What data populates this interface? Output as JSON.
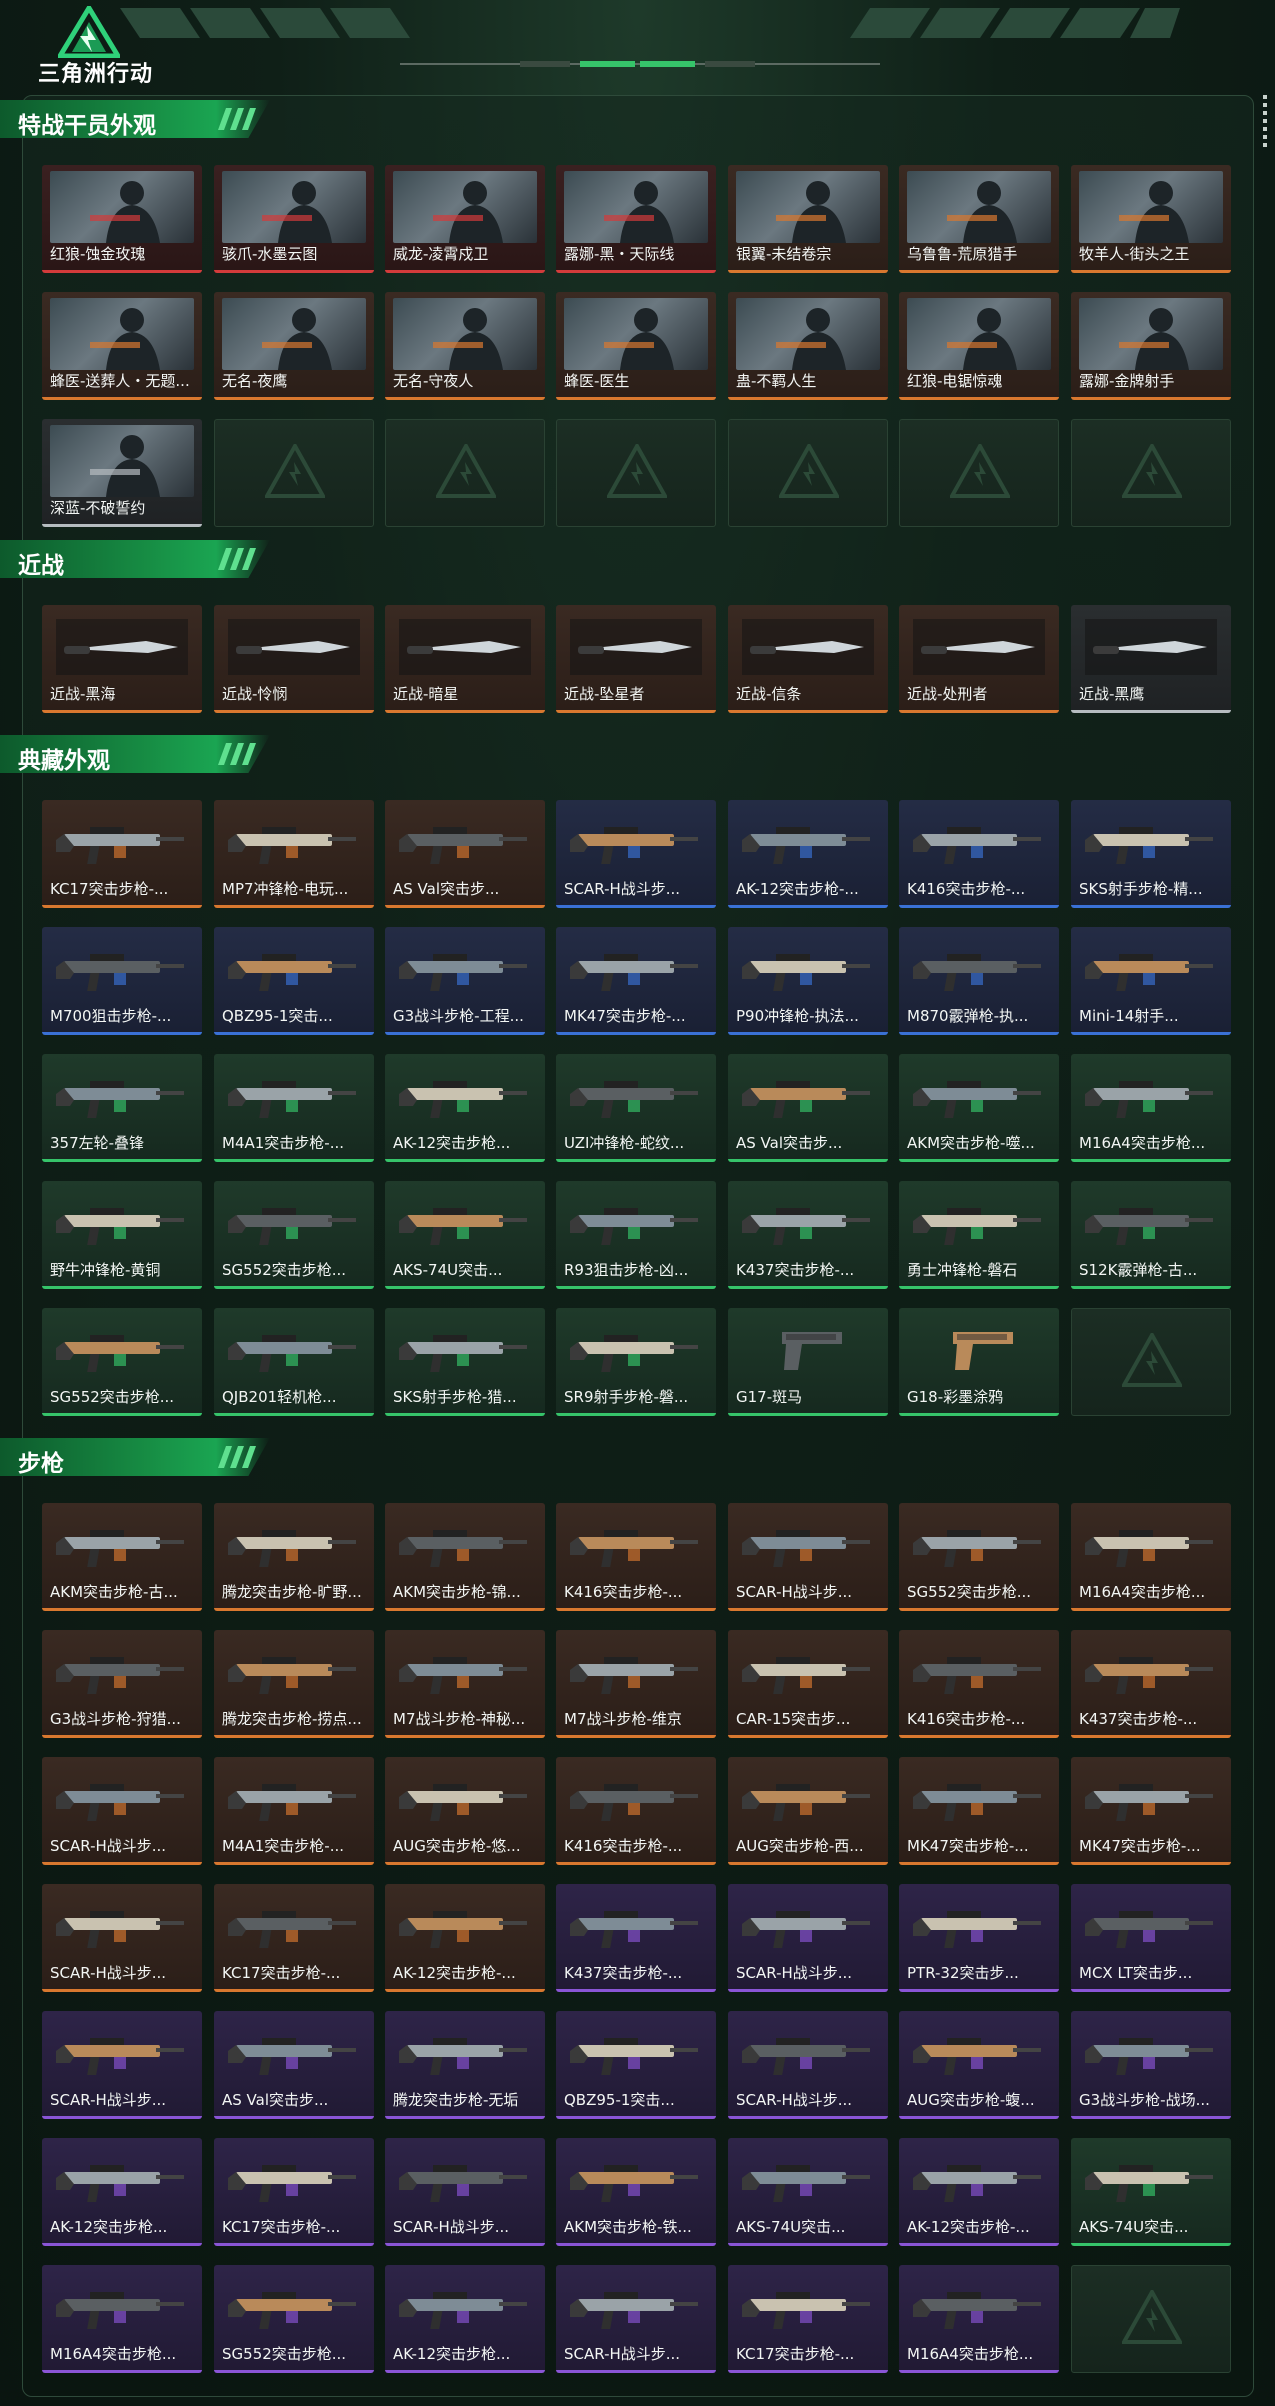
{
  "header": {
    "logo_text": "三角洲行动",
    "logo": "delta-triangle-logo"
  },
  "colors": {
    "orange": "#d9782f",
    "red": "#d33b3b",
    "blue": "#3a71d6",
    "green": "#36c46a",
    "purple": "#8a55d6",
    "grey": "#b6bcc0",
    "section_green": "#1aa552"
  },
  "sections": [
    {
      "title": "特战干员外观",
      "items": [
        {
          "label": "红狼-蚀金玫瑰",
          "rarity": "red",
          "kind": "operator"
        },
        {
          "label": "骇爪-水墨云图",
          "rarity": "red",
          "kind": "operator"
        },
        {
          "label": "威龙-凌霄戍卫",
          "rarity": "red",
          "kind": "operator"
        },
        {
          "label": "露娜-黑・天际线",
          "rarity": "red",
          "kind": "operator"
        },
        {
          "label": "银翼-未结卷宗",
          "rarity": "orange",
          "kind": "operator"
        },
        {
          "label": "乌鲁鲁-荒原猎手",
          "rarity": "orange",
          "kind": "operator"
        },
        {
          "label": "牧羊人-街头之王",
          "rarity": "orange",
          "kind": "operator"
        },
        {
          "label": "蜂医-送葬人・无题...",
          "rarity": "orange",
          "kind": "operator"
        },
        {
          "label": "无名-夜鹰",
          "rarity": "orange",
          "kind": "operator"
        },
        {
          "label": "无名-守夜人",
          "rarity": "orange",
          "kind": "operator"
        },
        {
          "label": "蜂医-医生",
          "rarity": "orange",
          "kind": "operator"
        },
        {
          "label": "蛊-不羁人生",
          "rarity": "orange",
          "kind": "operator"
        },
        {
          "label": "红狼-电锯惊魂",
          "rarity": "orange",
          "kind": "operator"
        },
        {
          "label": "露娜-金牌射手",
          "rarity": "orange",
          "kind": "operator"
        },
        {
          "label": "深蓝-不破誓约",
          "rarity": "grey",
          "kind": "operator"
        },
        {
          "empty": true
        },
        {
          "empty": true
        },
        {
          "empty": true
        },
        {
          "empty": true
        },
        {
          "empty": true
        },
        {
          "empty": true
        }
      ]
    },
    {
      "title": "近战",
      "items": [
        {
          "label": "近战-黑海",
          "rarity": "orange",
          "kind": "melee"
        },
        {
          "label": "近战-怜悯",
          "rarity": "orange",
          "kind": "melee"
        },
        {
          "label": "近战-暗星",
          "rarity": "orange",
          "kind": "melee"
        },
        {
          "label": "近战-坠星者",
          "rarity": "orange",
          "kind": "melee"
        },
        {
          "label": "近战-信条",
          "rarity": "orange",
          "kind": "melee"
        },
        {
          "label": "近战-处刑者",
          "rarity": "orange",
          "kind": "melee"
        },
        {
          "label": "近战-黑鹰",
          "rarity": "grey",
          "kind": "melee"
        }
      ]
    },
    {
      "title": "典藏外观",
      "items": [
        {
          "label": "KC17突击步枪-...",
          "rarity": "orange",
          "kind": "gun"
        },
        {
          "label": "MP7冲锋枪-电玩...",
          "rarity": "orange",
          "kind": "gun"
        },
        {
          "label": "AS Val突击步...",
          "rarity": "orange",
          "kind": "gun"
        },
        {
          "label": "SCAR-H战斗步...",
          "rarity": "blue",
          "kind": "gun"
        },
        {
          "label": "AK-12突击步枪-...",
          "rarity": "blue",
          "kind": "gun"
        },
        {
          "label": "K416突击步枪-...",
          "rarity": "blue",
          "kind": "gun"
        },
        {
          "label": "SKS射手步枪-精...",
          "rarity": "blue",
          "kind": "gun"
        },
        {
          "label": "M700狙击步枪-...",
          "rarity": "blue",
          "kind": "gun"
        },
        {
          "label": "QBZ95-1突击...",
          "rarity": "blue",
          "kind": "gun"
        },
        {
          "label": "G3战斗步枪-工程...",
          "rarity": "blue",
          "kind": "gun"
        },
        {
          "label": "MK47突击步枪-...",
          "rarity": "blue",
          "kind": "gun"
        },
        {
          "label": "P90冲锋枪-执法...",
          "rarity": "blue",
          "kind": "gun"
        },
        {
          "label": "M870霰弹枪-执...",
          "rarity": "blue",
          "kind": "gun"
        },
        {
          "label": "Mini-14射手...",
          "rarity": "blue",
          "kind": "gun"
        },
        {
          "label": "357左轮-叠锋",
          "rarity": "green",
          "kind": "gun"
        },
        {
          "label": "M4A1突击步枪-...",
          "rarity": "green",
          "kind": "gun"
        },
        {
          "label": "AK-12突击步枪...",
          "rarity": "green",
          "kind": "gun"
        },
        {
          "label": "UZI冲锋枪-蛇纹...",
          "rarity": "green",
          "kind": "gun"
        },
        {
          "label": "AS Val突击步...",
          "rarity": "green",
          "kind": "gun"
        },
        {
          "label": "AKM突击步枪-噬...",
          "rarity": "green",
          "kind": "gun"
        },
        {
          "label": "M16A4突击步枪...",
          "rarity": "green",
          "kind": "gun"
        },
        {
          "label": "野牛冲锋枪-黄铜",
          "rarity": "green",
          "kind": "gun"
        },
        {
          "label": "SG552突击步枪...",
          "rarity": "green",
          "kind": "gun"
        },
        {
          "label": "AKS-74U突击...",
          "rarity": "green",
          "kind": "gun"
        },
        {
          "label": "R93狙击步枪-凶...",
          "rarity": "green",
          "kind": "gun"
        },
        {
          "label": "K437突击步枪-...",
          "rarity": "green",
          "kind": "gun"
        },
        {
          "label": "勇士冲锋枪-磐石",
          "rarity": "green",
          "kind": "gun"
        },
        {
          "label": "S12K霰弹枪-古...",
          "rarity": "green",
          "kind": "gun"
        },
        {
          "label": "SG552突击步枪...",
          "rarity": "green",
          "kind": "gun"
        },
        {
          "label": "QJB201轻机枪...",
          "rarity": "green",
          "kind": "gun"
        },
        {
          "label": "SKS射手步枪-猎...",
          "rarity": "green",
          "kind": "gun"
        },
        {
          "label": "SR9射手步枪-磐...",
          "rarity": "green",
          "kind": "gun"
        },
        {
          "label": "G17-斑马",
          "rarity": "green",
          "kind": "pistol"
        },
        {
          "label": "G18-彩墨涂鸦",
          "rarity": "green",
          "kind": "pistol"
        },
        {
          "empty": true
        }
      ]
    },
    {
      "title": "步枪",
      "items": [
        {
          "label": "AKM突击步枪-古...",
          "rarity": "orange",
          "kind": "gun"
        },
        {
          "label": "腾龙突击步枪-旷野...",
          "rarity": "orange",
          "kind": "gun"
        },
        {
          "label": "AKM突击步枪-锦...",
          "rarity": "orange",
          "kind": "gun"
        },
        {
          "label": "K416突击步枪-...",
          "rarity": "orange",
          "kind": "gun"
        },
        {
          "label": "SCAR-H战斗步...",
          "rarity": "orange",
          "kind": "gun"
        },
        {
          "label": "SG552突击步枪...",
          "rarity": "orange",
          "kind": "gun"
        },
        {
          "label": "M16A4突击步枪...",
          "rarity": "orange",
          "kind": "gun"
        },
        {
          "label": "G3战斗步枪-狩猎...",
          "rarity": "orange",
          "kind": "gun"
        },
        {
          "label": "腾龙突击步枪-捞点...",
          "rarity": "orange",
          "kind": "gun"
        },
        {
          "label": "M7战斗步枪-神秘...",
          "rarity": "orange",
          "kind": "gun"
        },
        {
          "label": "M7战斗步枪-维京",
          "rarity": "orange",
          "kind": "gun"
        },
        {
          "label": "CAR-15突击步...",
          "rarity": "orange",
          "kind": "gun"
        },
        {
          "label": "K416突击步枪-...",
          "rarity": "orange",
          "kind": "gun"
        },
        {
          "label": "K437突击步枪-...",
          "rarity": "orange",
          "kind": "gun"
        },
        {
          "label": "SCAR-H战斗步...",
          "rarity": "orange",
          "kind": "gun"
        },
        {
          "label": "M4A1突击步枪-...",
          "rarity": "orange",
          "kind": "gun"
        },
        {
          "label": "AUG突击步枪-悠...",
          "rarity": "orange",
          "kind": "gun"
        },
        {
          "label": "K416突击步枪-...",
          "rarity": "orange",
          "kind": "gun"
        },
        {
          "label": "AUG突击步枪-西...",
          "rarity": "orange",
          "kind": "gun"
        },
        {
          "label": "MK47突击步枪-...",
          "rarity": "orange",
          "kind": "gun"
        },
        {
          "label": "MK47突击步枪-...",
          "rarity": "orange",
          "kind": "gun"
        },
        {
          "label": "SCAR-H战斗步...",
          "rarity": "orange",
          "kind": "gun"
        },
        {
          "label": "KC17突击步枪-...",
          "rarity": "orange",
          "kind": "gun"
        },
        {
          "label": "AK-12突击步枪-...",
          "rarity": "orange",
          "kind": "gun"
        },
        {
          "label": "K437突击步枪-...",
          "rarity": "purple",
          "kind": "gun"
        },
        {
          "label": "SCAR-H战斗步...",
          "rarity": "purple",
          "kind": "gun"
        },
        {
          "label": "PTR-32突击步...",
          "rarity": "purple",
          "kind": "gun"
        },
        {
          "label": "MCX LT突击步...",
          "rarity": "purple",
          "kind": "gun"
        },
        {
          "label": "SCAR-H战斗步...",
          "rarity": "purple",
          "kind": "gun"
        },
        {
          "label": "AS Val突击步...",
          "rarity": "purple",
          "kind": "gun"
        },
        {
          "label": "腾龙突击步枪-无垢",
          "rarity": "purple",
          "kind": "gun"
        },
        {
          "label": "QBZ95-1突击...",
          "rarity": "purple",
          "kind": "gun"
        },
        {
          "label": "SCAR-H战斗步...",
          "rarity": "purple",
          "kind": "gun"
        },
        {
          "label": "AUG突击步枪-蝮...",
          "rarity": "purple",
          "kind": "gun"
        },
        {
          "label": "G3战斗步枪-战场...",
          "rarity": "purple",
          "kind": "gun"
        },
        {
          "label": "AK-12突击步枪...",
          "rarity": "purple",
          "kind": "gun"
        },
        {
          "label": "KC17突击步枪-...",
          "rarity": "purple",
          "kind": "gun"
        },
        {
          "label": "SCAR-H战斗步...",
          "rarity": "purple",
          "kind": "gun"
        },
        {
          "label": "AKM突击步枪-铁...",
          "rarity": "purple",
          "kind": "gun"
        },
        {
          "label": "AKS-74U突击...",
          "rarity": "purple",
          "kind": "gun"
        },
        {
          "label": "AK-12突击步枪-...",
          "rarity": "purple",
          "kind": "gun"
        },
        {
          "label": "AKS-74U突击...",
          "rarity": "green",
          "kind": "gun"
        },
        {
          "label": "M16A4突击步枪...",
          "rarity": "purple",
          "kind": "gun"
        },
        {
          "label": "SG552突击步枪...",
          "rarity": "purple",
          "kind": "gun"
        },
        {
          "label": "AK-12突击步枪...",
          "rarity": "purple",
          "kind": "gun"
        },
        {
          "label": "SCAR-H战斗步...",
          "rarity": "purple",
          "kind": "gun"
        },
        {
          "label": "KC17突击步枪-...",
          "rarity": "purple",
          "kind": "gun"
        },
        {
          "label": "M16A4突击步枪...",
          "rarity": "purple",
          "kind": "gun"
        },
        {
          "empty": true
        }
      ]
    }
  ]
}
